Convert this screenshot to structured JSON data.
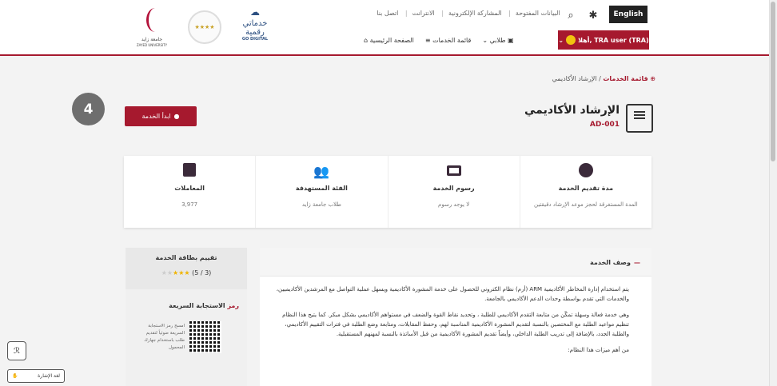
{
  "header": {
    "logo_zu_ar": "جامعة زايد",
    "logo_zu_en": "ZAYED UNIVERSITY",
    "logo_gd_ar": "خدماتي رقمية",
    "logo_gd_en": "GO DIGITAL",
    "top_links": [
      "البيانات المفتوحة",
      "المشاركة الإلكترونية",
      "الانترانت",
      "اتصل بنا"
    ],
    "lang_label": "English",
    "nav": {
      "home": "الصفحة الرئيسية",
      "services": "قائمة الخدمات",
      "students": "طلابي"
    },
    "user_label": "أهلا, TRA user (TRA)"
  },
  "breadcrumb": {
    "link": "قائمة الخدمات",
    "current": "الإرشاد الأكاديمي"
  },
  "service": {
    "title": "الإرشاد الأكاديمي",
    "code": "AD-001",
    "start_label": "ابدأ الخدمة"
  },
  "step_badge": "4",
  "stats": [
    {
      "label": "مدة تقديم الخدمة",
      "value": "المدة المستغرقة لحجز موعد الإرشاد دقيقتين",
      "icon": "clock-icon"
    },
    {
      "label": "رسوم الخدمة",
      "value": "لا يوجد رسوم",
      "icon": "money-icon"
    },
    {
      "label": "الفئة المستهدفة",
      "value": "طلاب جامعة زايد",
      "icon": "users-icon"
    },
    {
      "label": "المعاملات",
      "value": "3,977",
      "icon": "transactions-icon"
    }
  ],
  "description": {
    "heading": "وصف الخدمة",
    "p1": "يتم استخدام إدارة المخاطر الأكاديمية ARM (أرم) نظام الكتروني للحصول على خدمة المشورة الأكاديمية ويسهل عملية التواصل مع المرشدين الأكاديميين، والخدمات التي تقدم بواسطة وحدات الدعم الأكاديمي بالجامعة.",
    "p2": "وهي خدمة فعالة وسهلة تمكّن من متابعة التقدم الأكاديمي للطلبة ، وتحديد نقاط القوة والضعف في مستواهم الأكاديمي بشكل مبكر. كما يتيح هذا النظام تنظيم مواعيد الطلبة مع المختصين بالنسبة لتقديم المشورة الأكاديمية المناسبة لهم، وحفظ المقابلات، ومتابعة وضع الطلبة في فترات التقييم الأكاديمي، والطلبة الجدد، بالإضافة إلى تدريب الطلبة الداخلي، وأيضاً تقديم المشورة الأكاديمية من قبل الأساتذة بالنسبة لمهنهم المستقبلية.",
    "p3": "من أهم ميزات هذا النظام:"
  },
  "rating": {
    "title": "تقييم بطاقة الخدمة",
    "score": "(5 / 3)",
    "stars_on": 3,
    "stars_total": 5
  },
  "qr": {
    "title_hl": "رمز",
    "title_rest": "الاستجابة السريعة",
    "note": "امسح رمز الاستجابة السريعة ضوئياً لتقديم طلب باستخدام جهازك المحمول"
  },
  "sign_button": "لغة الإشارة",
  "colors": {
    "brand": "#a6192e",
    "dark": "#222222",
    "icon": "#3b2a3a"
  }
}
